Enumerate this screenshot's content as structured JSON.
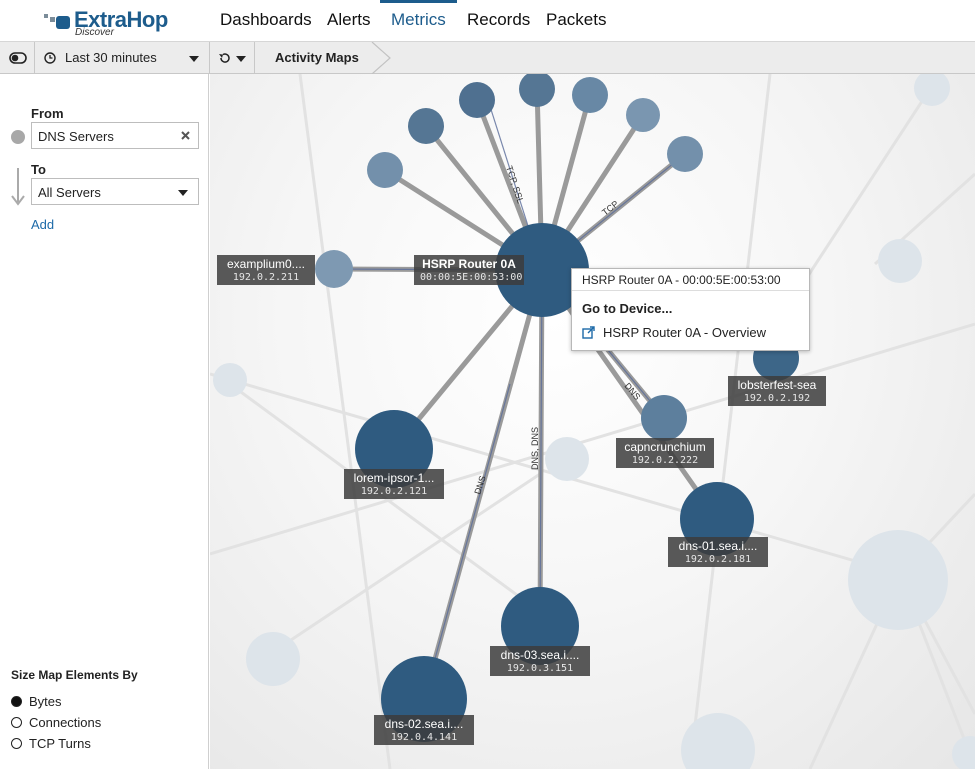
{
  "header": {
    "brand": "ExtraHop",
    "brand_sub": "Discover",
    "nav": [
      {
        "label": "Dashboards"
      },
      {
        "label": "Alerts"
      },
      {
        "label": "Metrics",
        "active": true
      },
      {
        "label": "Records"
      },
      {
        "label": "Packets"
      }
    ]
  },
  "toolbar": {
    "time_range": "Last 30 minutes",
    "breadcrumb": "Activity Maps"
  },
  "sidebar": {
    "from_label": "From",
    "from_value": "DNS Servers",
    "to_label": "To",
    "to_value": "All Servers",
    "add_label": "Add",
    "size_by_label": "Size Map Elements By",
    "size_options": [
      {
        "label": "Bytes",
        "selected": true
      },
      {
        "label": "Connections",
        "selected": false
      },
      {
        "label": "TCP Turns",
        "selected": false
      }
    ]
  },
  "map": {
    "center_node": {
      "name": "HSRP Router 0A",
      "addr": "00:00:5E:00:53:00"
    },
    "nodes": [
      {
        "name": "examplium0....",
        "addr": "192.0.2.211"
      },
      {
        "name": "lobsterfest-sea",
        "addr": "192.0.2.192"
      },
      {
        "name": "capncrunchium",
        "addr": "192.0.2.222"
      },
      {
        "name": "lorem-ipsor-1...",
        "addr": "192.0.2.121"
      },
      {
        "name": "dns-01.sea.i....",
        "addr": "192.0.2.181"
      },
      {
        "name": "dns-03.sea.i....",
        "addr": "192.0.3.151"
      },
      {
        "name": "dns-02.sea.i....",
        "addr": "192.0.4.141"
      }
    ],
    "edge_labels": [
      "TCP, SSL",
      "TCP",
      "DNS",
      "DNS, DNS",
      "DNS"
    ],
    "colors": {
      "node": "#2f5b80",
      "node_light": "#6f8fac",
      "brand": "#1d5c8c"
    }
  },
  "tooltip": {
    "title": "HSRP Router 0A - 00:00:5E:00:53:00",
    "goto": "Go to Device...",
    "overview": "HSRP Router 0A - Overview"
  }
}
